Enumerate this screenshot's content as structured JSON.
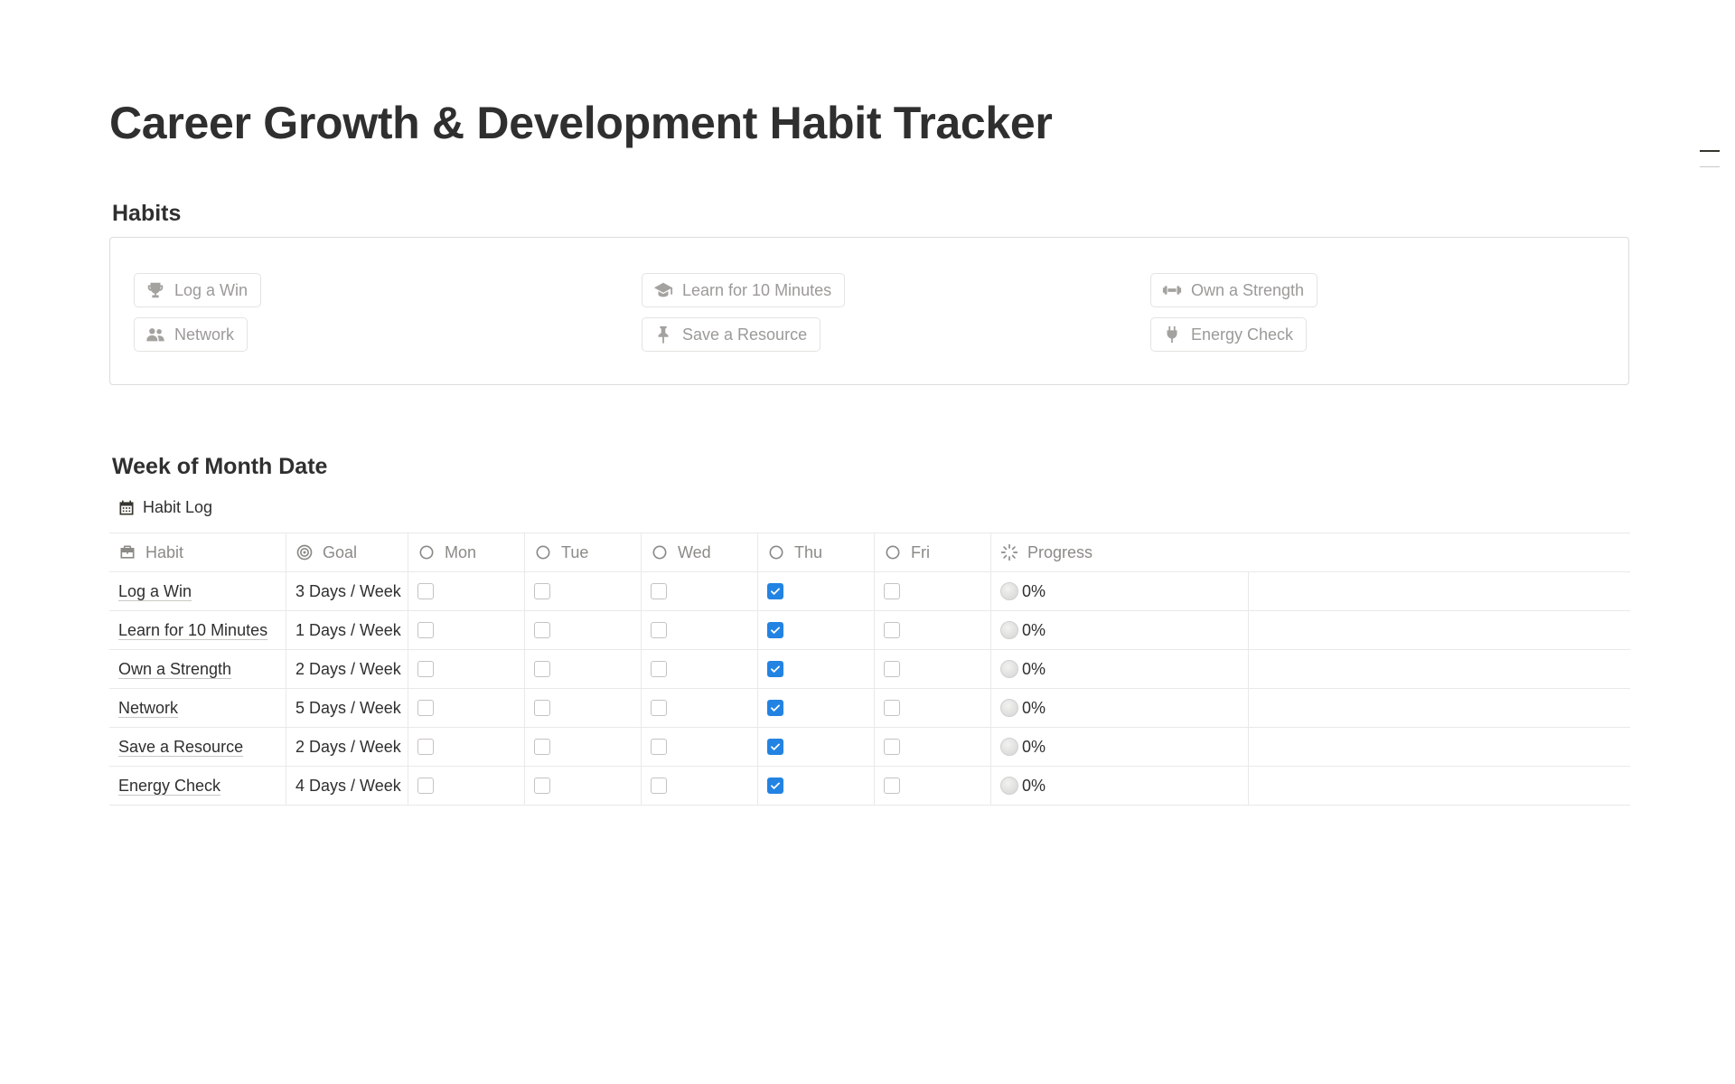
{
  "page": {
    "title": "Career Growth & Development Habit Tracker"
  },
  "habits_section": {
    "heading": "Habits",
    "chips": [
      {
        "label": "Log a Win",
        "icon": "trophy-icon"
      },
      {
        "label": "Learn for 10 Minutes",
        "icon": "graduation-cap-icon"
      },
      {
        "label": "Own a Strength",
        "icon": "dumbbell-icon"
      },
      {
        "label": "Network",
        "icon": "people-icon"
      },
      {
        "label": "Save a Resource",
        "icon": "pin-icon"
      },
      {
        "label": "Energy Check",
        "icon": "plug-icon"
      }
    ]
  },
  "week_section": {
    "heading": "Week of Month Date",
    "view_label": "Habit Log",
    "view_icon": "calendar-icon"
  },
  "table": {
    "headers": {
      "habit": "Habit",
      "goal": "Goal",
      "mon": "Mon",
      "tue": "Tue",
      "wed": "Wed",
      "thu": "Thu",
      "fri": "Fri",
      "progress": "Progress"
    },
    "rows": [
      {
        "habit": "Log a Win",
        "goal": "3 Days / Week",
        "mon": false,
        "tue": false,
        "wed": false,
        "thu": true,
        "fri": false,
        "progress": "0%"
      },
      {
        "habit": "Learn for 10 Minutes",
        "goal": "1 Days / Week",
        "mon": false,
        "tue": false,
        "wed": false,
        "thu": true,
        "fri": false,
        "progress": "0%"
      },
      {
        "habit": "Own a Strength",
        "goal": "2 Days / Week",
        "mon": false,
        "tue": false,
        "wed": false,
        "thu": true,
        "fri": false,
        "progress": "0%"
      },
      {
        "habit": "Network",
        "goal": "5 Days / Week",
        "mon": false,
        "tue": false,
        "wed": false,
        "thu": true,
        "fri": false,
        "progress": "0%"
      },
      {
        "habit": "Save a Resource",
        "goal": "2 Days / Week",
        "mon": false,
        "tue": false,
        "wed": false,
        "thu": true,
        "fri": false,
        "progress": "0%"
      },
      {
        "habit": "Energy Check",
        "goal": "4 Days / Week",
        "mon": false,
        "tue": false,
        "wed": false,
        "thu": true,
        "fri": false,
        "progress": "0%"
      }
    ]
  },
  "colors": {
    "checkbox_checked": "#2383e2",
    "text_primary": "#37352f",
    "text_muted": "#9b9a97"
  }
}
